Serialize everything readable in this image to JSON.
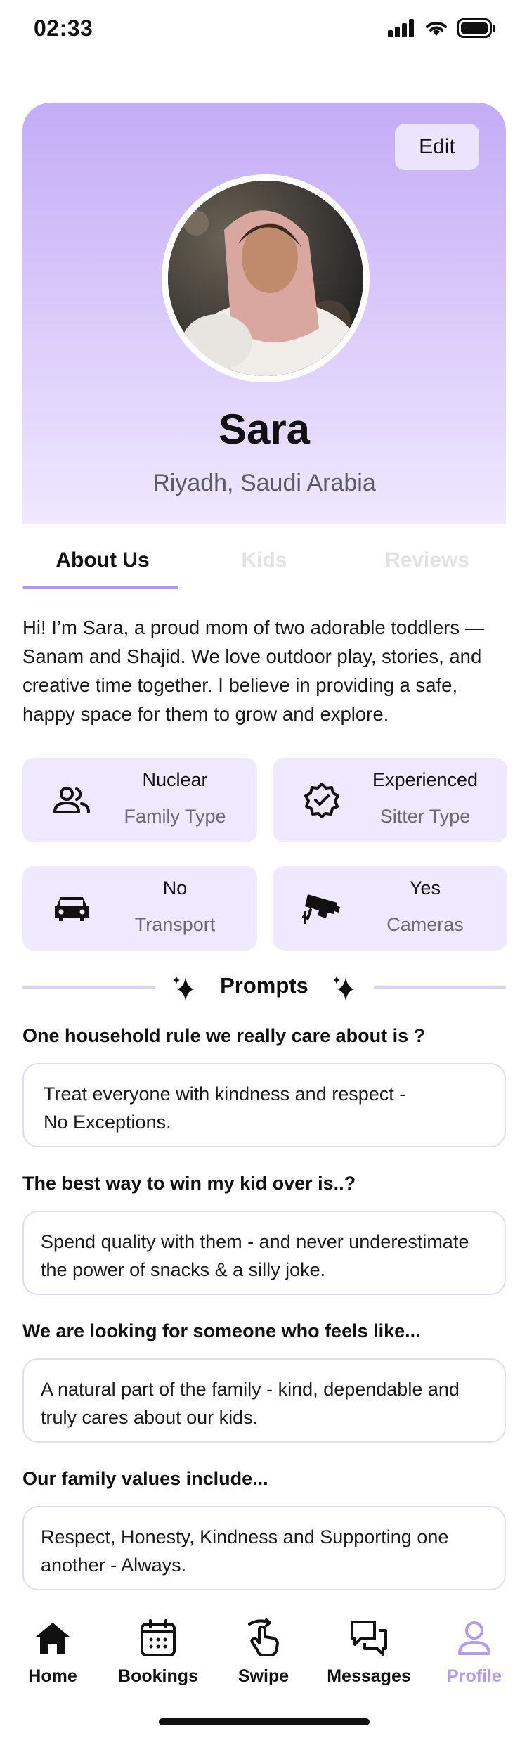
{
  "status_bar": {
    "time": "02:33"
  },
  "profile": {
    "edit_label": "Edit",
    "name": "Sara",
    "location": "Riyadh, Saudi Arabia"
  },
  "tabs": [
    {
      "label": "About Us",
      "active": true
    },
    {
      "label": "Kids",
      "active": false
    },
    {
      "label": "Reviews",
      "active": false
    }
  ],
  "about": {
    "lines": [
      "Hi! I’m Sara, a proud mom of two adorable toddlers —",
      "Sanam and Shajid. We love outdoor play, stories, and",
      "creative time together. I believe in providing a safe,",
      "happy space for them to grow and explore."
    ]
  },
  "info_cards": [
    {
      "icon": "people-icon",
      "value": "Nuclear",
      "label": "Family Type"
    },
    {
      "icon": "verified-badge-icon",
      "value": "Experienced",
      "label": "Sitter Type"
    },
    {
      "icon": "car-icon",
      "value": "No",
      "label": "Transport"
    },
    {
      "icon": "camera-icon",
      "value": "Yes",
      "label": "Cameras"
    }
  ],
  "prompts": {
    "title": "Prompts",
    "items": [
      {
        "question": "One household rule we really care about is ?",
        "answer_lines": [
          "Treat everyone with kindness and respect -",
          "No Exceptions."
        ]
      },
      {
        "question": "The best way to win my kid over is..?",
        "answer_lines": [
          "Spend quality with them - and never underestimate",
          "the power of snacks & a silly joke."
        ]
      },
      {
        "question": "We are looking for someone who feels like...",
        "answer_lines": [
          "A natural part of the family - kind, dependable and",
          "truly cares about our kids."
        ]
      },
      {
        "question": "Our family values include...",
        "answer_lines": [
          "Respect, Honesty, Kindness and Supporting one",
          "another - Always."
        ]
      }
    ]
  },
  "nav": [
    {
      "label": "Home",
      "icon": "home-icon",
      "active": false
    },
    {
      "label": "Bookings",
      "icon": "calendar-icon",
      "active": false
    },
    {
      "label": "Swipe",
      "icon": "swipe-hand-icon",
      "active": false
    },
    {
      "label": "Messages",
      "icon": "messages-icon",
      "active": false
    },
    {
      "label": "Profile",
      "icon": "user-icon",
      "active": true
    }
  ],
  "colors": {
    "accent": "#b096f2",
    "card_bg": "#efe9ff",
    "inactive_tab": "#e3e3e6",
    "active_nav": "#b49af3",
    "text": "#111111"
  }
}
